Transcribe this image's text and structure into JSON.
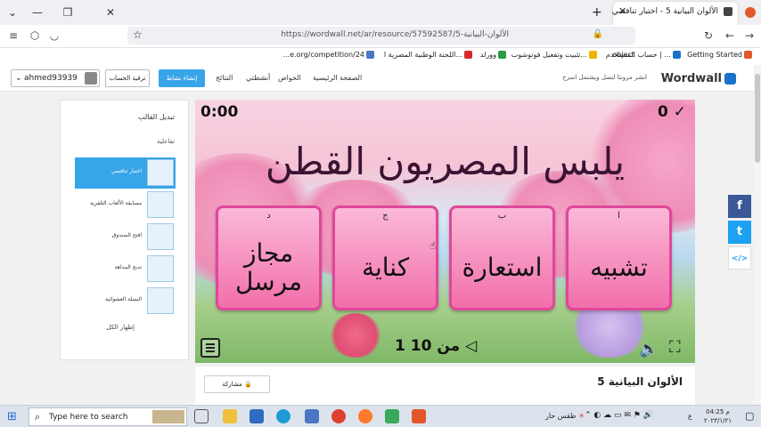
{
  "browser": {
    "tab_title": "الألوان البيانية 5 - اختبار تنافسي",
    "new_tab": "+",
    "url": "https://wordwall.net/ar/resource/57592587/5-الألوان-البيانية",
    "bookmarks": [
      {
        "label": "Getting Started",
        "color": "#e2572b"
      },
      {
        "label": "حساب المستخدم | ...",
        "color": "#1a73c9"
      },
      {
        "label": "object",
        "color": "#777777"
      },
      {
        "label": "تثبيت وتفعيل فوتوشوب...",
        "color": "#f0b400"
      },
      {
        "label": "وورلد",
        "color": "#2a9d46"
      },
      {
        "label": "اللجنة الوطنية المصرية ا...",
        "color": "#d72b2b"
      },
      {
        "label": "...e.org/competition/24",
        "color": "#4a76c4"
      }
    ]
  },
  "site": {
    "logo": "Wordwall",
    "promo": "انشر مرونتا لتصل ويشتمل اسرح",
    "nav": [
      "الصفحة الرئيسية",
      "الخواص",
      "أنشطتي",
      "النتائج"
    ],
    "create_button": "إنشاء نشاط",
    "upgrade_button": "ترقية الحساب",
    "username": "ahmed93939"
  },
  "template_panel": {
    "title": "تبديل القالب",
    "group": "تفاعلية",
    "items": [
      {
        "label": "اختبار تنافسي",
        "selected": true
      },
      {
        "label": "مسابقة الألعاب التلفزية",
        "selected": false
      },
      {
        "label": "افتح الصندوق",
        "selected": false
      },
      {
        "label": "تدبج المداهة",
        "selected": false
      },
      {
        "label": "البسلة العشوائية",
        "selected": false
      }
    ],
    "show_all": "إظهار الكل"
  },
  "game": {
    "timer": "0:00",
    "score": "0",
    "score_icon": "check-icon",
    "question": "يلبس المصريون القطن",
    "answers": [
      {
        "letter": "ا",
        "text": "تشبيه"
      },
      {
        "letter": "ب",
        "text": "استعارة"
      },
      {
        "letter": "ج",
        "text": "كناية"
      },
      {
        "letter": "د",
        "text": "مجاز مرسل"
      }
    ],
    "pager": "1 من 10"
  },
  "resource": {
    "title": "الألوان البيانية 5",
    "share": "مشاركة"
  },
  "social": [
    {
      "name": "facebook",
      "glyph": "f",
      "color": "#3b5998"
    },
    {
      "name": "twitter",
      "glyph": "t",
      "color": "#1da1f2"
    },
    {
      "name": "embed",
      "glyph": "</>",
      "color": "#ffffff"
    }
  ],
  "taskbar": {
    "search_placeholder": "Type here to search",
    "weather": "طقس حار",
    "lang": "ع",
    "time": "04:25 م",
    "date": "٢٠٢٣/١/٢١"
  }
}
